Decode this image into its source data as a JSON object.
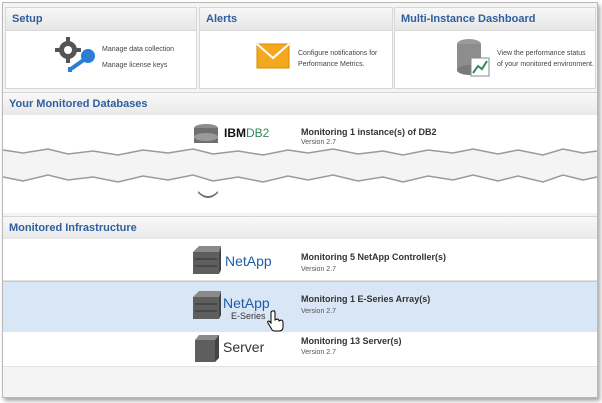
{
  "cards": [
    {
      "title": "Setup",
      "lines": [
        "Manage data collection",
        "Manage license keys"
      ],
      "icon": "gear-key-icon"
    },
    {
      "title": "Alerts",
      "lines": [
        "Configure notifications for",
        "Performance Metrics."
      ],
      "icon": "envelope-icon"
    },
    {
      "title": "Multi-Instance Dashboard",
      "lines": [
        "View the performance status",
        "of your monitored environment."
      ],
      "icon": "database-chart-icon"
    }
  ],
  "databases": {
    "header": "Your Monitored Databases",
    "items": [
      {
        "logo_prefix": "IBM",
        "logo_suffix": "DB2",
        "title": "Monitoring 1 instance(s) of DB2",
        "version": "Version 2.7"
      }
    ]
  },
  "infrastructure": {
    "header": "Monitored Infrastructure",
    "items": [
      {
        "logo": "NetApp",
        "sub": "",
        "title": "Monitoring 5 NetApp Controller(s)",
        "version": "Version 2.7",
        "selected": false
      },
      {
        "logo": "NetApp",
        "sub": "E-Series",
        "title": "Monitoring 1 E-Series Array(s)",
        "version": "Version 2.7",
        "selected": true
      },
      {
        "logo": "Server",
        "sub": "",
        "title": "Monitoring 13 Server(s)",
        "version": "Version 2.7",
        "selected": false
      }
    ]
  },
  "colors": {
    "accent": "#2f5f9e",
    "selected": "#d8e6f5",
    "netapp_blue": "#1f5da8",
    "db2_green": "#2e8b57"
  }
}
